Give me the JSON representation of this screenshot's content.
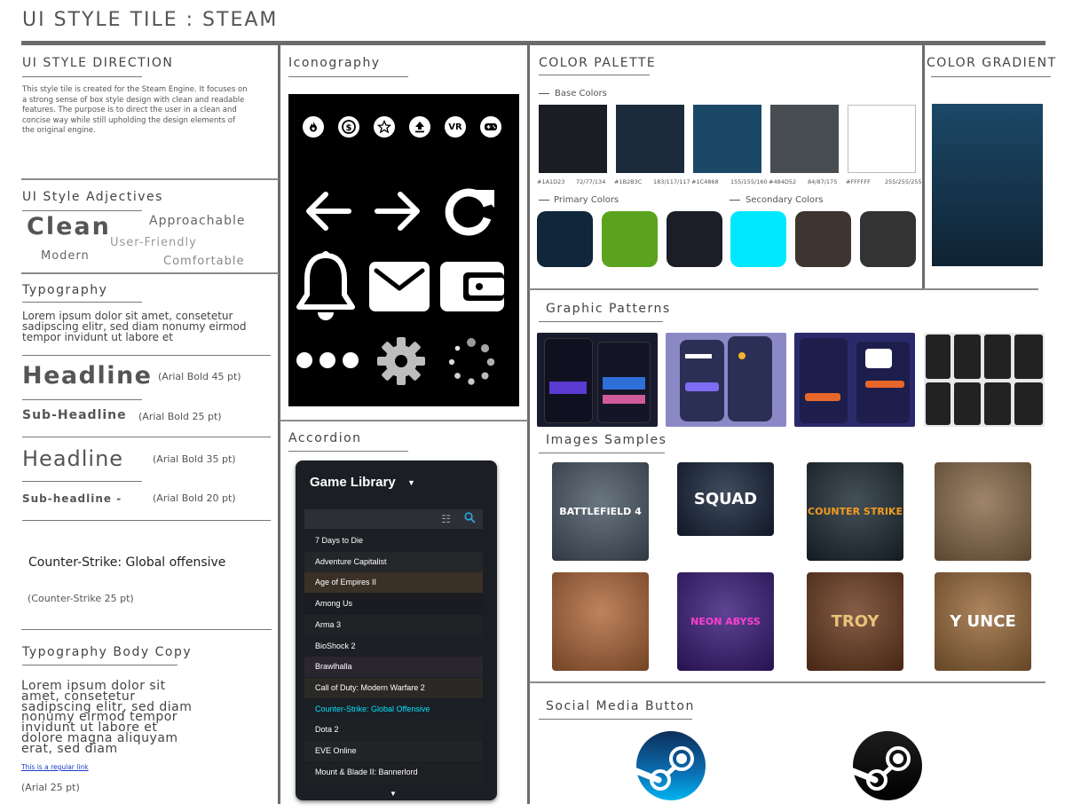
{
  "title": "UI STYLE TILE : STEAM",
  "direction": {
    "heading": "UI STYLE DIRECTION",
    "body": "This style tile is created for the Steam Engine. It focuses on a strong sense of box style design with clean and readable features. The purpose is to direct the user in a clean and concise way while still upholding the design elements of the original engine."
  },
  "adjectives": {
    "heading": "UI Style Adjectives",
    "clean": "Clean",
    "approachable": "Approachable",
    "user_friendly": "User-Friendly",
    "modern": "Modern",
    "comfortable": "Comfortable"
  },
  "typography": {
    "heading": "Typography",
    "lorem": "Lorem ipsum dolor sit amet, consetetur sadipscing elitr, sed diam nonumy eirmod tempor invidunt ut labore et",
    "headline1": "Headline",
    "headline1_note": "(Arial Bold 45 pt)",
    "sub1": "Sub-Headline",
    "sub1_note": "(Arial Bold 25 pt)",
    "headline2": "Headline",
    "headline2_note": "(Arial Bold 35 pt)",
    "sub2": "Sub-headline -",
    "sub2_note": "(Arial Bold 20 pt)",
    "cs": "Counter-Strike: Global offensive",
    "cs_note": "(Counter-Strike 25 pt)"
  },
  "body_copy": {
    "heading": "Typography Body Copy",
    "text": "Lorem ipsum dolor sit amet, consetetur sadipscing elitr, sed diam nonumy eirmod tempor invidunt ut labore et dolore magna aliquyam erat, sed diam",
    "link": "This is a regular link",
    "note": "(Arial 25 pt)"
  },
  "iconography": {
    "heading": "Iconography",
    "small_icons": [
      "fire-icon",
      "dollar-icon",
      "star-icon",
      "upload-icon",
      "vr-icon",
      "gamepad-icon"
    ],
    "vr_label": "VR",
    "big_icons": [
      "arrow-left-icon",
      "arrow-right-icon",
      "refresh-icon",
      "bell-icon",
      "mail-icon",
      "wallet-icon",
      "more-icon",
      "gear-icon",
      "loading-icon"
    ]
  },
  "accordion": {
    "heading": "Accordion",
    "title": "Game Library",
    "items": [
      "7 Days to Die",
      "Adventure Capitalist",
      "Age of Empires II",
      "Among Us",
      "Arma 3",
      "BioShock 2",
      "Brawlhalla",
      "Call of Duty: Modern Warfare 2",
      "Counter-Strike: Global Offensive",
      "Dota 2",
      "EVE Online",
      "Mount & Blade II: Bannerlord"
    ],
    "active_index": 8,
    "active_color": "#00e5ff"
  },
  "palette": {
    "heading": "COLOR PALETTE",
    "base_heading": "Base Colors",
    "base": [
      {
        "hex": "#1A1D23",
        "label": "#1A1D23",
        "rgb": "72/77/134"
      },
      {
        "hex": "#1B2B3C",
        "label": "#1B2B3C",
        "rgb": "183/117/117"
      },
      {
        "hex": "#1C4868",
        "label": "#1C4868",
        "rgb": "155/155/160"
      },
      {
        "hex": "#484D52",
        "label": "#484D52",
        "rgb": "84/87/175"
      },
      {
        "hex": "#FFFFFF",
        "label": "#FFFFFF",
        "rgb": "255/255/255"
      }
    ],
    "primary_heading": "Primary Colors",
    "primary": [
      "#10263b",
      "#5ba31c",
      "#1b1e26"
    ],
    "secondary_heading": "Secondary Colors",
    "secondary": [
      "#00e8ff",
      "#3f3530",
      "#333333"
    ]
  },
  "gradient": {
    "heading": "COLOR GRADIENT",
    "top": "#1c4868",
    "bottom": "#0f2333"
  },
  "patterns": {
    "heading": "Graphic Patterns"
  },
  "samples": {
    "heading": "Images Samples",
    "items": [
      {
        "text": "BATTLEFIELD 4",
        "bg": "#4a5866",
        "fg": "#ffffff"
      },
      {
        "text": "SQUAD",
        "bg": "#16243a",
        "fg": "#ffffff"
      },
      {
        "text": "COUNTER STRIKE",
        "bg": "#1c2a34",
        "fg": "#f29b1d"
      },
      {
        "text": "",
        "bg": "#8a6b4a",
        "fg": "#ffffff"
      },
      {
        "text": "",
        "bg": "#b0683a",
        "fg": "#ffffff"
      },
      {
        "text": "NEON ABYSS",
        "bg": "#3a1b7a",
        "fg": "#ff3fd0"
      },
      {
        "text": "TROY",
        "bg": "#6b3a1e",
        "fg": "#e9c27a"
      },
      {
        "text": "Y UNCE",
        "bg": "#9a6a3a",
        "fg": "#ffffff"
      }
    ]
  },
  "social": {
    "heading": "Social Media Button",
    "buttons": [
      "steam-blue-icon",
      "steam-black-icon"
    ]
  }
}
